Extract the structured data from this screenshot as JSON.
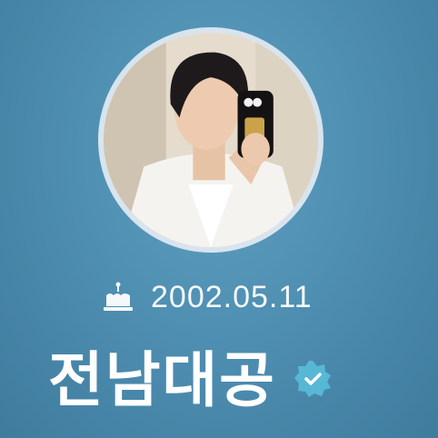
{
  "profile": {
    "birthday": "2002.05.11",
    "name": "전남대공",
    "icons": {
      "birthday": "cake-icon",
      "verified": "verified-badge-icon",
      "avatar": "profile-photo"
    },
    "colors": {
      "background": "#4f8fb2",
      "avatar_ring": "#d8e4ee",
      "verified_badge": "#57b8d6"
    }
  }
}
